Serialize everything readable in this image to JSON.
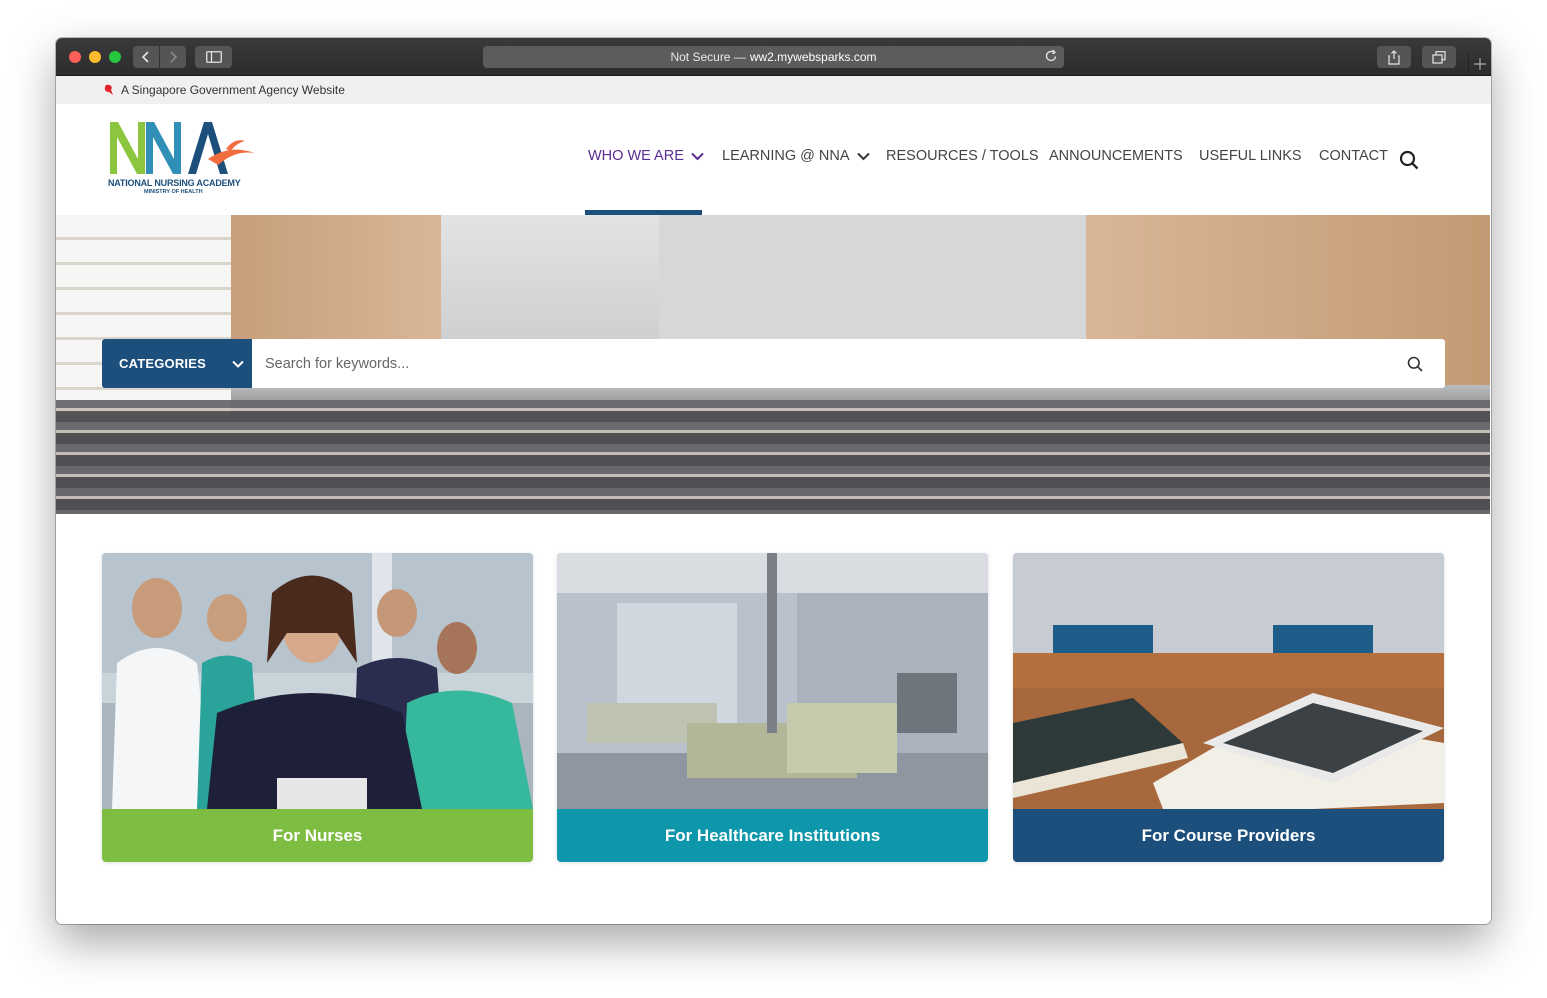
{
  "browser": {
    "address_prefix": "Not Secure —",
    "address_domain": "ww2.mywebsparks.com"
  },
  "govbar": {
    "text": "A Singapore Government Agency Website"
  },
  "logo": {
    "name": "NATIONAL NURSING ACADEMY",
    "sub": "MINISTRY OF HEALTH",
    "colors": {
      "n1": "#8cc63f",
      "n2": "#2f8fb6",
      "a": "#1c4f7b",
      "swoosh": "#f26d3d"
    }
  },
  "nav": {
    "items": [
      {
        "label": "WHO WE ARE",
        "has_dropdown": true,
        "active": true
      },
      {
        "label": "LEARNING @ NNA",
        "has_dropdown": true,
        "active": false
      },
      {
        "label": "RESOURCES / TOOLS",
        "has_dropdown": false,
        "active": false
      },
      {
        "label": "ANNOUNCEMENTS",
        "has_dropdown": false,
        "active": false
      },
      {
        "label": "USEFUL LINKS",
        "has_dropdown": false,
        "active": false
      },
      {
        "label": "CONTACT",
        "has_dropdown": false,
        "active": false
      }
    ],
    "active_color": "#5a2d91",
    "active_bar_color": "#1c4f7b"
  },
  "hero": {
    "categories_label": "CATEGORIES",
    "search_placeholder": "Search for keywords..."
  },
  "cards": [
    {
      "label": "For Nurses",
      "color": "#7dbd42"
    },
    {
      "label": "For Healthcare Institutions",
      "color": "#0e96ab"
    },
    {
      "label": "For Course Providers",
      "color": "#1c4f7b"
    }
  ]
}
